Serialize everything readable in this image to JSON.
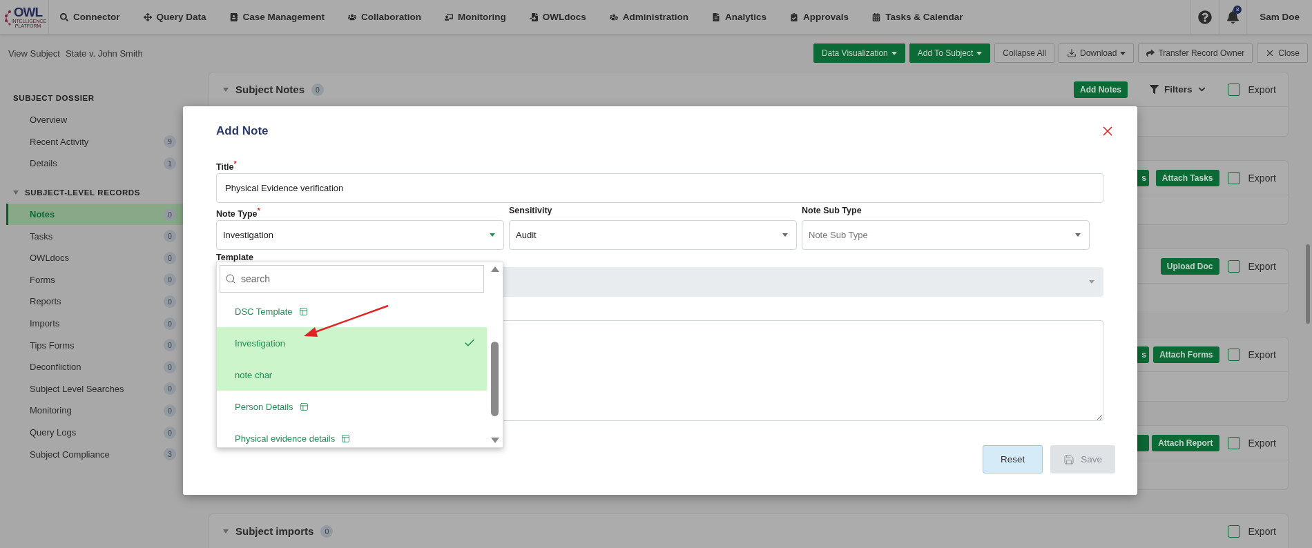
{
  "logo": {
    "name": "OWL",
    "subtitle": "INTELLIGENCE PLATFORM"
  },
  "nav": {
    "items": [
      {
        "label": "Connector"
      },
      {
        "label": "Query Data"
      },
      {
        "label": "Case Management"
      },
      {
        "label": "Collaboration"
      },
      {
        "label": "Monitoring"
      },
      {
        "label": "OWLdocs"
      },
      {
        "label": "Administration"
      },
      {
        "label": "Analytics"
      },
      {
        "label": "Approvals"
      },
      {
        "label": "Tasks & Calendar"
      }
    ],
    "notification_count": "8",
    "user": "Sam Doe"
  },
  "breadcrumb": [
    "View Subject",
    "State v. John Smith"
  ],
  "toolbar": [
    {
      "label": "Data Visualization",
      "kind": "primary",
      "caret": true
    },
    {
      "label": "Add To Subject",
      "kind": "primary",
      "caret": true
    },
    {
      "label": "Collapse All",
      "kind": "outline",
      "caret": false
    },
    {
      "label": "Download",
      "kind": "outline",
      "caret": true
    },
    {
      "label": "Transfer Record Owner",
      "kind": "outline",
      "caret": false
    },
    {
      "label": "Close",
      "kind": "outline",
      "caret": false
    }
  ],
  "sidebar": {
    "sections": [
      {
        "title": "SUBJECT DOSSIER",
        "items": [
          {
            "label": "Overview",
            "selected": false
          },
          {
            "label": "Recent Activity",
            "count": "9",
            "selected": false
          },
          {
            "label": "Details",
            "count": "1",
            "selected": false
          }
        ]
      },
      {
        "title": "SUBJECT-LEVEL RECORDS",
        "expanded": true,
        "items": [
          {
            "label": "Notes",
            "count": "0",
            "selected": true
          },
          {
            "label": "Tasks",
            "count": "0",
            "selected": false
          },
          {
            "label": "OWLdocs",
            "count": "0",
            "selected": false
          },
          {
            "label": "Forms",
            "count": "0",
            "selected": false
          },
          {
            "label": "Reports",
            "count": "0",
            "selected": false
          },
          {
            "label": "Imports",
            "count": "0",
            "selected": false
          },
          {
            "label": "Tips Forms",
            "count": "0",
            "selected": false
          },
          {
            "label": "Deconfliction",
            "count": "0",
            "selected": false
          },
          {
            "label": "Subject Level Searches",
            "count": "0",
            "selected": false
          },
          {
            "label": "Monitoring",
            "count": "0",
            "selected": false
          },
          {
            "label": "Query Logs",
            "count": "0",
            "selected": false
          },
          {
            "label": "Subject Compliance",
            "count": "3",
            "selected": false
          }
        ]
      }
    ]
  },
  "cards": [
    {
      "title": "Subject Notes",
      "count": "0",
      "expanded": true,
      "actions": [
        {
          "kind": "button",
          "label": "Add Notes"
        },
        {
          "kind": "filter",
          "label": "Filters"
        }
      ],
      "export": {
        "label": "Export",
        "checked": false
      }
    },
    {
      "actions": [
        {
          "kind": "clipped",
          "label": "s"
        },
        {
          "kind": "button",
          "label": "Attach Tasks"
        }
      ],
      "export": {
        "label": "Export",
        "checked": false
      }
    },
    {
      "actions": [
        {
          "kind": "button",
          "label": "Upload Doc"
        }
      ],
      "export": {
        "label": "Export",
        "checked": false
      }
    },
    {
      "actions": [
        {
          "kind": "clipped",
          "label": "s"
        },
        {
          "kind": "button",
          "label": "Attach Forms"
        }
      ],
      "export": {
        "label": "Export",
        "checked": false
      }
    },
    {
      "actions": [
        {
          "kind": "clipped"
        },
        {
          "kind": "button",
          "label": "Attach Report"
        }
      ],
      "export": {
        "label": "Export",
        "checked": false
      }
    },
    {
      "title": "Subject imports",
      "count": "0",
      "expanded": true,
      "export": {
        "label": "Export",
        "checked": false
      }
    }
  ],
  "modal": {
    "title": "Add Note",
    "required_mark": "*",
    "title_field": {
      "label": "Title",
      "required": true,
      "value": "Physical Evidence verification"
    },
    "note_type": {
      "label": "Note Type",
      "required": true,
      "value": "Investigation",
      "open": true
    },
    "sensitivity": {
      "label": "Sensitivity",
      "required": false,
      "value": "Audit"
    },
    "sub_type": {
      "label": "Note Sub Type",
      "required": false,
      "placeholder": "Note Sub Type"
    },
    "template": {
      "label": "Template",
      "disabled": true
    },
    "dropdown": {
      "search_placeholder": "search",
      "options": [
        {
          "label": "DSC Template",
          "template_icon": true,
          "selected": false,
          "highlighted": false
        },
        {
          "label": "Investigation",
          "template_icon": false,
          "selected": true,
          "highlighted": true
        },
        {
          "label": "note char",
          "template_icon": false,
          "selected": false,
          "highlighted": true
        },
        {
          "label": "Person Details",
          "template_icon": true,
          "selected": false,
          "highlighted": false
        },
        {
          "label": "Physical evidence details",
          "template_icon": true,
          "selected": false,
          "highlighted": false
        }
      ]
    },
    "buttons": [
      {
        "label": "Reset",
        "kind": "reset",
        "disabled": false
      },
      {
        "label": "Save",
        "kind": "save",
        "disabled": true
      }
    ]
  }
}
